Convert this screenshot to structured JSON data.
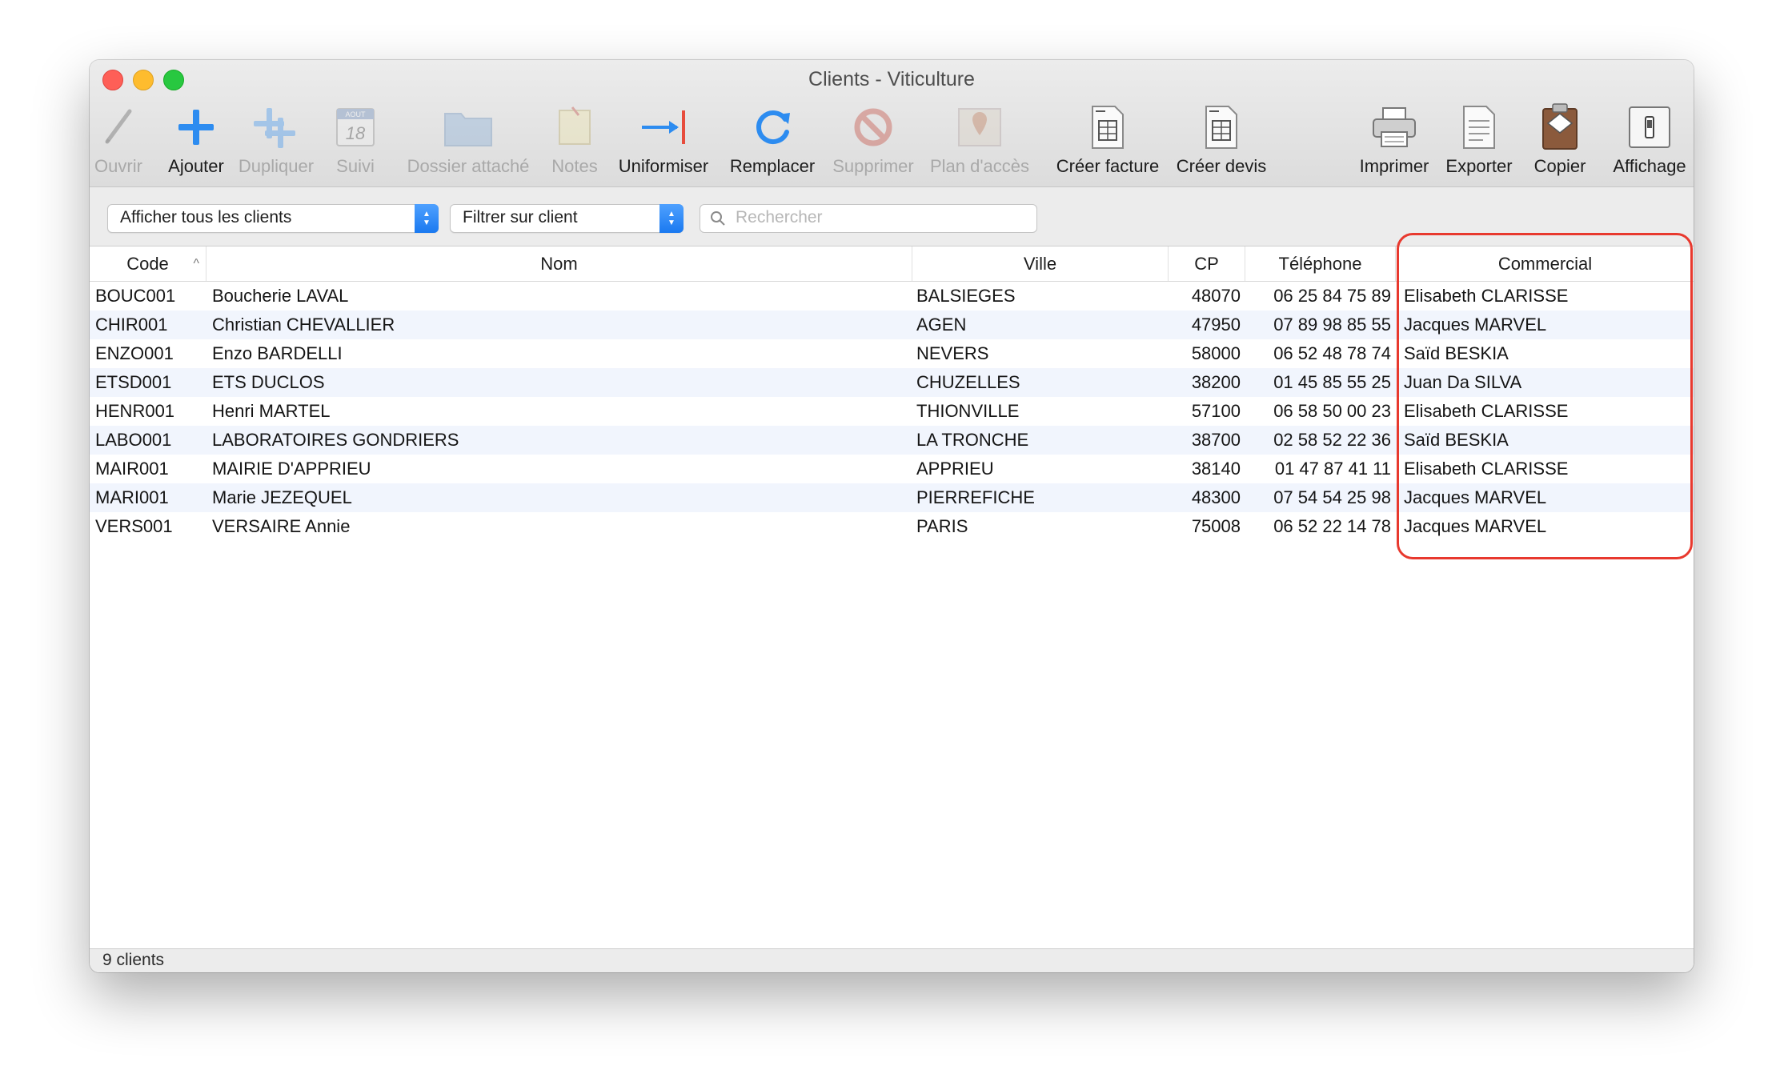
{
  "window": {
    "title": "Clients - Viticulture"
  },
  "toolbar": {
    "open": "Ouvrir",
    "add": "Ajouter",
    "duplicate": "Dupliquer",
    "followup": "Suivi",
    "calendar_month": "AOUT",
    "calendar_day": "18",
    "attached_folder": "Dossier attaché",
    "notes": "Notes",
    "uniformize": "Uniformiser",
    "replace": "Remplacer",
    "delete": "Supprimer",
    "access_map": "Plan d'accès",
    "create_invoice": "Créer facture",
    "create_quote": "Créer devis",
    "print": "Imprimer",
    "export": "Exporter",
    "copy": "Copier",
    "display": "Affichage"
  },
  "filters": {
    "show_select": "Afficher tous les clients",
    "filter_select": "Filtrer sur client",
    "search_placeholder": "Rechercher"
  },
  "table": {
    "columns": {
      "code": "Code",
      "name": "Nom",
      "city": "Ville",
      "zip": "CP",
      "phone": "Téléphone",
      "sales": "Commercial"
    },
    "rows": [
      {
        "code": "BOUC001",
        "name": "Boucherie LAVAL",
        "city": "BALSIEGES",
        "zip": "48070",
        "phone": "06 25 84 75 89",
        "sales": "Elisabeth CLARISSE"
      },
      {
        "code": "CHIR001",
        "name": "Christian CHEVALLIER",
        "city": "AGEN",
        "zip": "47950",
        "phone": "07 89 98 85 55",
        "sales": "Jacques MARVEL"
      },
      {
        "code": "ENZO001",
        "name": "Enzo BARDELLI",
        "city": "NEVERS",
        "zip": "58000",
        "phone": "06 52 48 78 74",
        "sales": "Saïd BESKIA"
      },
      {
        "code": "ETSD001",
        "name": "ETS DUCLOS",
        "city": "CHUZELLES",
        "zip": "38200",
        "phone": "01 45 85 55 25",
        "sales": "Juan Da SILVA"
      },
      {
        "code": "HENR001",
        "name": "Henri MARTEL",
        "city": "THIONVILLE",
        "zip": "57100",
        "phone": "06 58 50 00 23",
        "sales": "Elisabeth CLARISSE"
      },
      {
        "code": "LABO001",
        "name": "LABORATOIRES GONDRIERS",
        "city": "LA TRONCHE",
        "zip": "38700",
        "phone": "02 58 52 22 36",
        "sales": "Saïd BESKIA"
      },
      {
        "code": "MAIR001",
        "name": "MAIRIE D'APPRIEU",
        "city": "APPRIEU",
        "zip": "38140",
        "phone": "01 47 87 41 11",
        "sales": "Elisabeth CLARISSE"
      },
      {
        "code": "MARI001",
        "name": "Marie JEZEQUEL",
        "city": "PIERREFICHE",
        "zip": "48300",
        "phone": "07 54 54 25 98",
        "sales": "Jacques MARVEL"
      },
      {
        "code": "VERS001",
        "name": "VERSAIRE Annie",
        "city": "PARIS",
        "zip": "75008",
        "phone": "06 52 22 14 78",
        "sales": "Jacques MARVEL"
      }
    ]
  },
  "status": {
    "count": "9 clients"
  },
  "colors": {
    "accent": "#1a79f0",
    "highlight": "#e8392e",
    "alt_row": "#f1f5fd"
  }
}
